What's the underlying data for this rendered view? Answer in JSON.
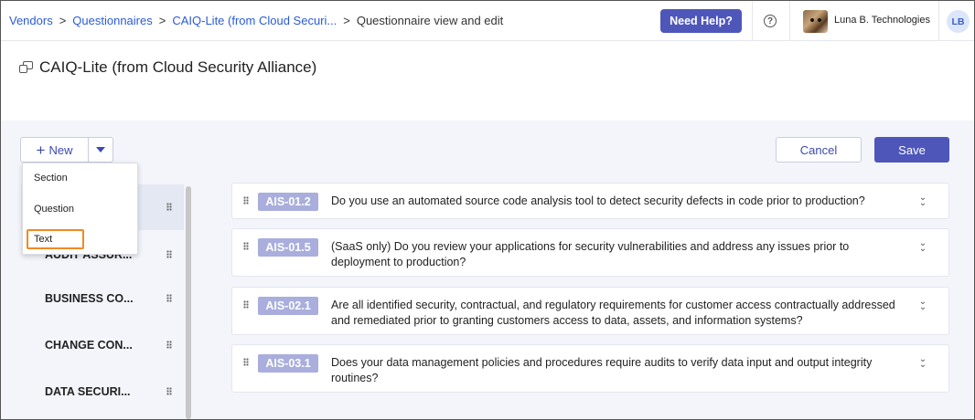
{
  "breadcrumb": {
    "items": [
      "Vendors",
      "Questionnaires",
      "CAIQ-Lite (from Cloud Securi...",
      "Questionnaire view and edit"
    ],
    "separator": ">"
  },
  "header": {
    "help_label": "Need Help?",
    "help_icon": "?",
    "org_name": "Luna B. Technologies",
    "user_initials": "LB"
  },
  "page": {
    "title": "CAIQ-Lite (from Cloud Security Alliance)"
  },
  "toolbar": {
    "new_label": "New",
    "new_icon": "+",
    "cancel_label": "Cancel",
    "save_label": "Save"
  },
  "dropdown": {
    "items": [
      "Section",
      "Question",
      "Text"
    ]
  },
  "sidebar": {
    "items": [
      "",
      "AUDIT ASSUR...",
      "BUSINESS CO...",
      "CHANGE CON...",
      "DATA SECURI..."
    ]
  },
  "questions": [
    {
      "id": "AIS-01.2",
      "text": "Do you use an automated source code analysis tool to detect security defects in code prior to production?"
    },
    {
      "id": "AIS-01.5",
      "text": "(SaaS only) Do you review your applications for security vulnerabilities and address any issues prior to deployment to production?"
    },
    {
      "id": "AIS-02.1",
      "text": "Are all identified security, contractual, and regulatory requirements for customer access contractually addressed and remediated prior to granting customers access to data, assets, and information systems?"
    },
    {
      "id": "AIS-03.1",
      "text": "Does your data management policies and procedures require audits to verify data input and output integrity routines?"
    }
  ],
  "colors": {
    "primary": "#4e57b9",
    "link": "#2a5bd7",
    "tag": "#a9aedd",
    "highlight": "#f08a24"
  }
}
